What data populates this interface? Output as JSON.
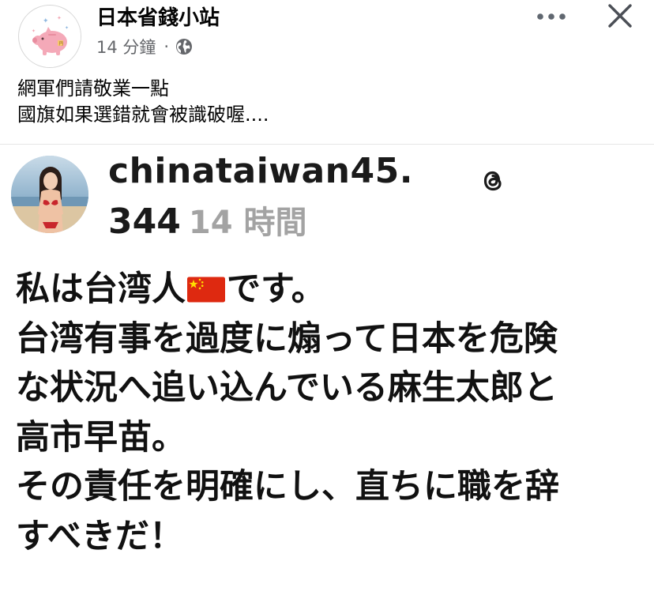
{
  "post": {
    "page_name": "日本省錢小站",
    "timestamp": "14 分鐘",
    "separator": "·",
    "audience_icon": "globe-icon",
    "menu_icon": "more-icon",
    "close_icon": "close-icon",
    "caption_lines": [
      "網軍們請敬業一點",
      "國旗如果選錯就會被識破喔...."
    ]
  },
  "shared_post": {
    "username": "chinataiwan45.",
    "follower_count": "344",
    "time": "14 時間",
    "app_icon": "threads-icon",
    "body": {
      "line1_before_flag": "私は台湾人",
      "flag_icon": "china-flag-icon",
      "line1_after_flag": "です。",
      "lines": [
        "台湾有事を過度に煽って日本を危険",
        "な状況へ追い込んでいる麻生太郎と",
        "高市早苗。",
        "その責任を明確にし、直ちに職を辞",
        "すべきだ！"
      ]
    }
  },
  "colors": {
    "text_primary": "#050505",
    "text_secondary": "#65676b",
    "time_gray": "#a3a3a3",
    "flag_red": "#de2910",
    "flag_yellow": "#ffde00"
  }
}
